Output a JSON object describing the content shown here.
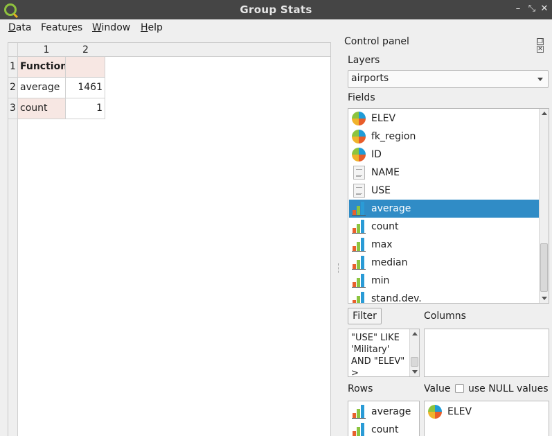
{
  "window": {
    "title": "Group Stats",
    "minimize": "–",
    "restore": "⤡",
    "close": "✕"
  },
  "menu": {
    "items": [
      {
        "mnemonic": "D",
        "rest": "ata"
      },
      {
        "pre": "Featu",
        "mnemonic": "r",
        "rest": "es"
      },
      {
        "mnemonic": "W",
        "rest": "indow"
      },
      {
        "mnemonic": "H",
        "rest": "elp"
      }
    ]
  },
  "table": {
    "col_headers": [
      "1",
      "2"
    ],
    "row_headers": [
      "1",
      "2",
      "3"
    ],
    "rows": [
      [
        "Function",
        ""
      ],
      [
        "average",
        "1461"
      ],
      [
        "count",
        "1"
      ]
    ]
  },
  "panel": {
    "title": "Control panel",
    "float_icon": "❐",
    "close_icon": "✕",
    "layers_label": "Layers",
    "layer_selected": "airports",
    "fields_label": "Fields",
    "fields": [
      {
        "name": "ELEV",
        "icon": "numeric-field-icon"
      },
      {
        "name": "fk_region",
        "icon": "numeric-field-icon"
      },
      {
        "name": "ID",
        "icon": "numeric-field-icon"
      },
      {
        "name": "NAME",
        "icon": "text-field-icon"
      },
      {
        "name": "USE",
        "icon": "text-field-icon"
      },
      {
        "name": "average",
        "icon": "statistic-icon",
        "selected": true
      },
      {
        "name": "count",
        "icon": "statistic-icon"
      },
      {
        "name": "max",
        "icon": "statistic-icon"
      },
      {
        "name": "median",
        "icon": "statistic-icon"
      },
      {
        "name": "min",
        "icon": "statistic-icon"
      },
      {
        "name": "stand.dev.",
        "icon": "statistic-icon"
      }
    ],
    "filter_button": "Filter",
    "filter_expression": "\"USE\" LIKE 'Military' AND \"ELEV\" >",
    "columns_label": "Columns",
    "rows_label": "Rows",
    "rows_items": [
      {
        "name": "average",
        "icon": "statistic-icon"
      },
      {
        "name": "count",
        "icon": "statistic-icon"
      }
    ],
    "value_label": "Value",
    "use_null_label": "use NULL values",
    "use_null_checked": false,
    "value_items": [
      {
        "name": "ELEV",
        "icon": "numeric-field-icon"
      }
    ]
  }
}
